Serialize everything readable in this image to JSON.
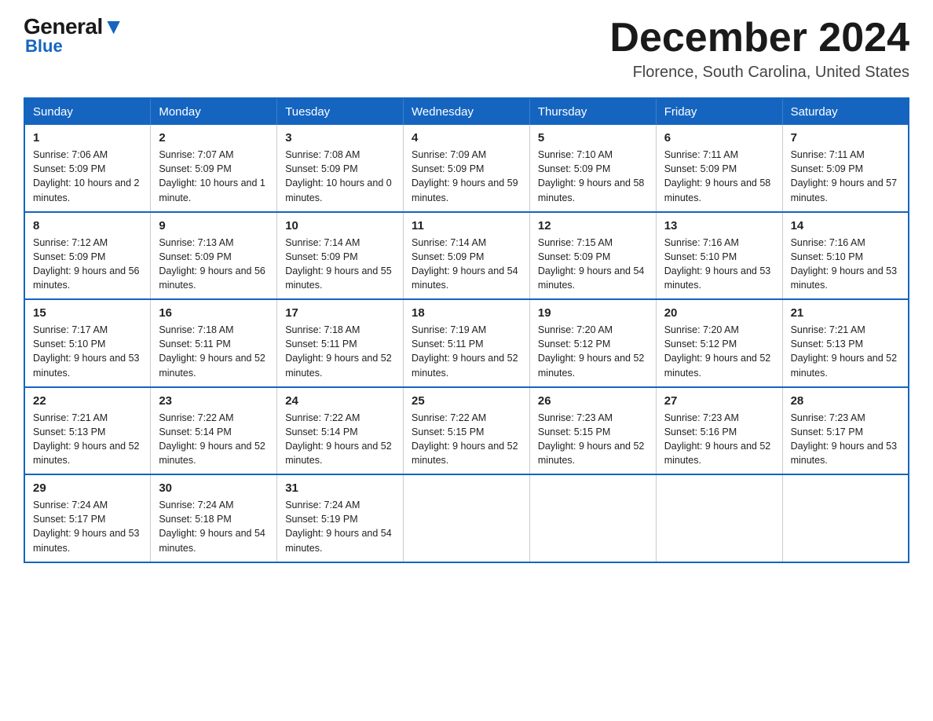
{
  "logo": {
    "general": "General",
    "blue": "Blue"
  },
  "title": "December 2024",
  "location": "Florence, South Carolina, United States",
  "days_of_week": [
    "Sunday",
    "Monday",
    "Tuesday",
    "Wednesday",
    "Thursday",
    "Friday",
    "Saturday"
  ],
  "weeks": [
    [
      {
        "day": "1",
        "sunrise": "7:06 AM",
        "sunset": "5:09 PM",
        "daylight": "10 hours and 2 minutes."
      },
      {
        "day": "2",
        "sunrise": "7:07 AM",
        "sunset": "5:09 PM",
        "daylight": "10 hours and 1 minute."
      },
      {
        "day": "3",
        "sunrise": "7:08 AM",
        "sunset": "5:09 PM",
        "daylight": "10 hours and 0 minutes."
      },
      {
        "day": "4",
        "sunrise": "7:09 AM",
        "sunset": "5:09 PM",
        "daylight": "9 hours and 59 minutes."
      },
      {
        "day": "5",
        "sunrise": "7:10 AM",
        "sunset": "5:09 PM",
        "daylight": "9 hours and 58 minutes."
      },
      {
        "day": "6",
        "sunrise": "7:11 AM",
        "sunset": "5:09 PM",
        "daylight": "9 hours and 58 minutes."
      },
      {
        "day": "7",
        "sunrise": "7:11 AM",
        "sunset": "5:09 PM",
        "daylight": "9 hours and 57 minutes."
      }
    ],
    [
      {
        "day": "8",
        "sunrise": "7:12 AM",
        "sunset": "5:09 PM",
        "daylight": "9 hours and 56 minutes."
      },
      {
        "day": "9",
        "sunrise": "7:13 AM",
        "sunset": "5:09 PM",
        "daylight": "9 hours and 56 minutes."
      },
      {
        "day": "10",
        "sunrise": "7:14 AM",
        "sunset": "5:09 PM",
        "daylight": "9 hours and 55 minutes."
      },
      {
        "day": "11",
        "sunrise": "7:14 AM",
        "sunset": "5:09 PM",
        "daylight": "9 hours and 54 minutes."
      },
      {
        "day": "12",
        "sunrise": "7:15 AM",
        "sunset": "5:09 PM",
        "daylight": "9 hours and 54 minutes."
      },
      {
        "day": "13",
        "sunrise": "7:16 AM",
        "sunset": "5:10 PM",
        "daylight": "9 hours and 53 minutes."
      },
      {
        "day": "14",
        "sunrise": "7:16 AM",
        "sunset": "5:10 PM",
        "daylight": "9 hours and 53 minutes."
      }
    ],
    [
      {
        "day": "15",
        "sunrise": "7:17 AM",
        "sunset": "5:10 PM",
        "daylight": "9 hours and 53 minutes."
      },
      {
        "day": "16",
        "sunrise": "7:18 AM",
        "sunset": "5:11 PM",
        "daylight": "9 hours and 52 minutes."
      },
      {
        "day": "17",
        "sunrise": "7:18 AM",
        "sunset": "5:11 PM",
        "daylight": "9 hours and 52 minutes."
      },
      {
        "day": "18",
        "sunrise": "7:19 AM",
        "sunset": "5:11 PM",
        "daylight": "9 hours and 52 minutes."
      },
      {
        "day": "19",
        "sunrise": "7:20 AM",
        "sunset": "5:12 PM",
        "daylight": "9 hours and 52 minutes."
      },
      {
        "day": "20",
        "sunrise": "7:20 AM",
        "sunset": "5:12 PM",
        "daylight": "9 hours and 52 minutes."
      },
      {
        "day": "21",
        "sunrise": "7:21 AM",
        "sunset": "5:13 PM",
        "daylight": "9 hours and 52 minutes."
      }
    ],
    [
      {
        "day": "22",
        "sunrise": "7:21 AM",
        "sunset": "5:13 PM",
        "daylight": "9 hours and 52 minutes."
      },
      {
        "day": "23",
        "sunrise": "7:22 AM",
        "sunset": "5:14 PM",
        "daylight": "9 hours and 52 minutes."
      },
      {
        "day": "24",
        "sunrise": "7:22 AM",
        "sunset": "5:14 PM",
        "daylight": "9 hours and 52 minutes."
      },
      {
        "day": "25",
        "sunrise": "7:22 AM",
        "sunset": "5:15 PM",
        "daylight": "9 hours and 52 minutes."
      },
      {
        "day": "26",
        "sunrise": "7:23 AM",
        "sunset": "5:15 PM",
        "daylight": "9 hours and 52 minutes."
      },
      {
        "day": "27",
        "sunrise": "7:23 AM",
        "sunset": "5:16 PM",
        "daylight": "9 hours and 52 minutes."
      },
      {
        "day": "28",
        "sunrise": "7:23 AM",
        "sunset": "5:17 PM",
        "daylight": "9 hours and 53 minutes."
      }
    ],
    [
      {
        "day": "29",
        "sunrise": "7:24 AM",
        "sunset": "5:17 PM",
        "daylight": "9 hours and 53 minutes."
      },
      {
        "day": "30",
        "sunrise": "7:24 AM",
        "sunset": "5:18 PM",
        "daylight": "9 hours and 54 minutes."
      },
      {
        "day": "31",
        "sunrise": "7:24 AM",
        "sunset": "5:19 PM",
        "daylight": "9 hours and 54 minutes."
      },
      null,
      null,
      null,
      null
    ]
  ]
}
